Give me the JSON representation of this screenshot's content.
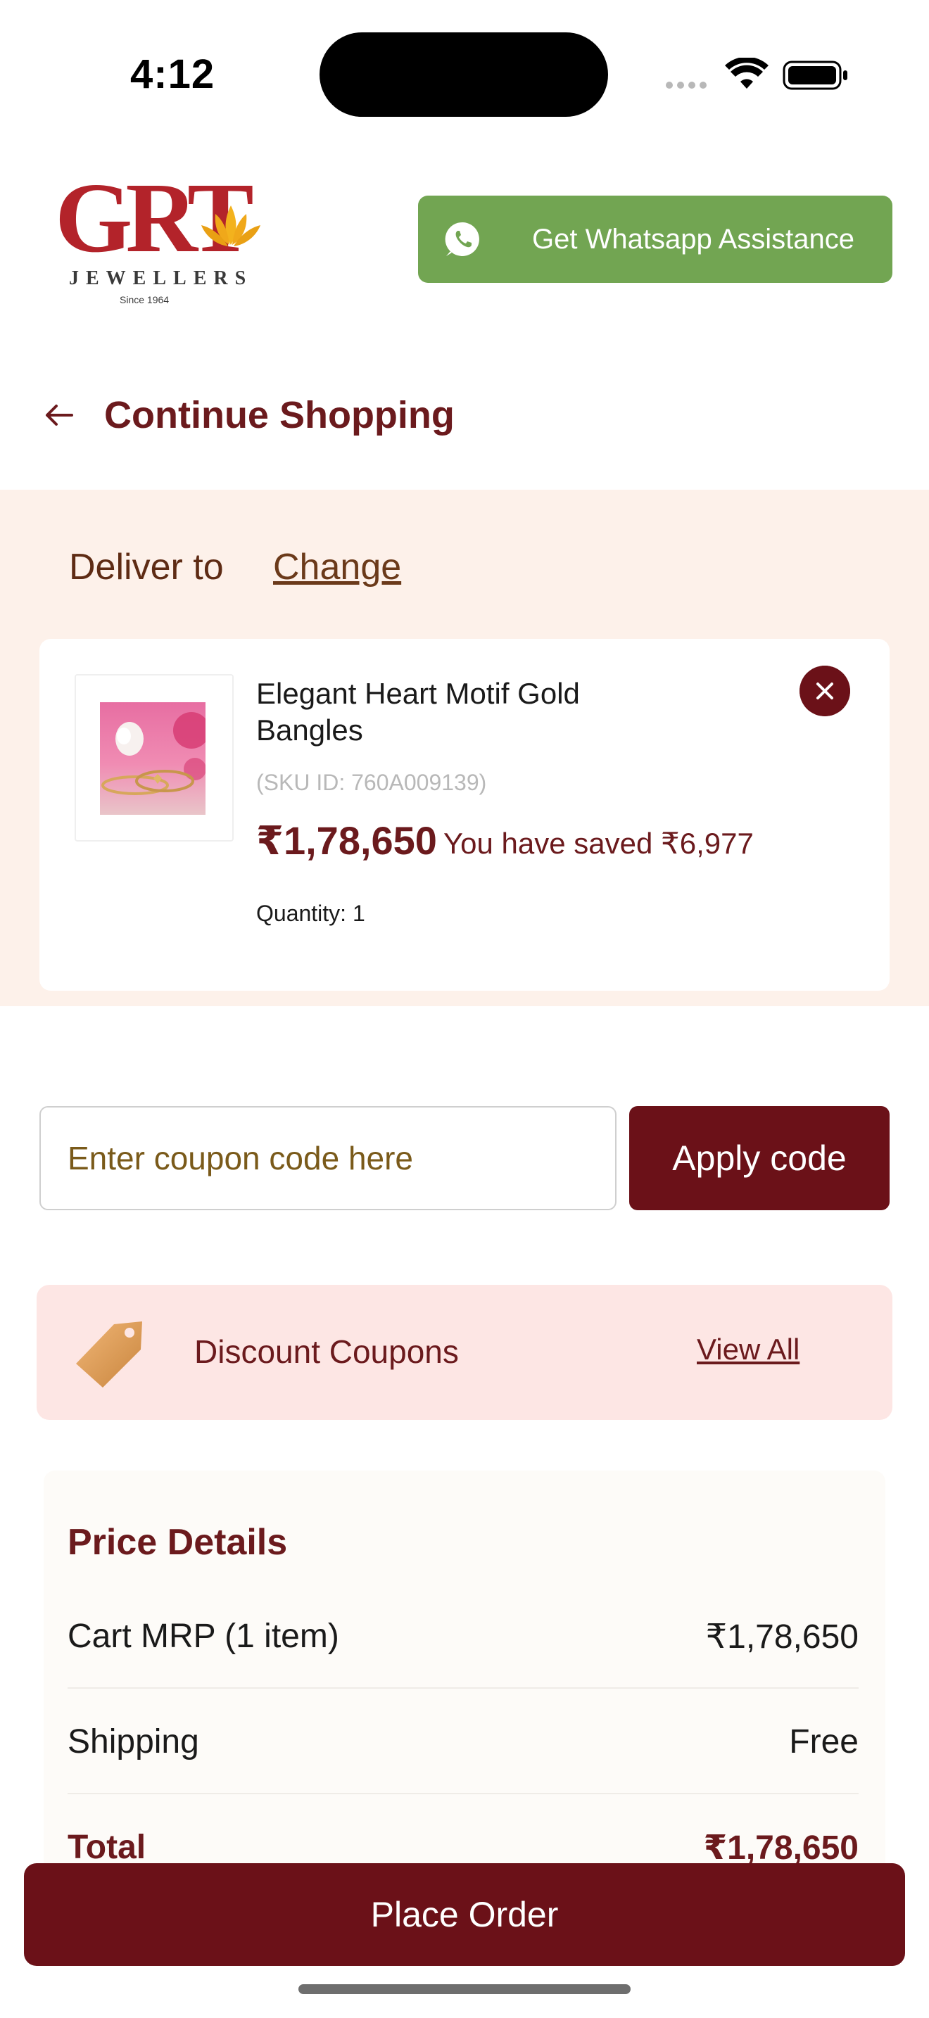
{
  "status_bar": {
    "time": "4:12"
  },
  "header": {
    "logo": {
      "brand": "GRT",
      "subtitle": "JEWELLERS",
      "since": "Since 1964"
    },
    "whatsapp_label": "Get Whatsapp Assistance"
  },
  "nav": {
    "back_label": "Continue Shopping"
  },
  "delivery": {
    "label": "Deliver to",
    "change_label": "Change"
  },
  "cart_item": {
    "name": "Elegant Heart Motif Gold Bangles",
    "sku": "(SKU ID: 760A009139)",
    "price": "₹1,78,650",
    "saved": "You have saved ₹6,977",
    "quantity": "Quantity: 1"
  },
  "coupon": {
    "placeholder": "Enter coupon code here",
    "apply_label": "Apply code",
    "discount_label": "Discount Coupons",
    "view_all_label": "View All"
  },
  "price_details": {
    "title": "Price Details",
    "rows": [
      {
        "label": "Cart MRP (1  item)",
        "value": "₹1,78,650"
      },
      {
        "label": "Shipping",
        "value": "Free"
      },
      {
        "label": "Total",
        "value": "₹1,78,650"
      }
    ]
  },
  "footer": {
    "place_order_label": "Place Order"
  },
  "colors": {
    "maroon": "#6b1118",
    "whatsapp_green": "#72a552",
    "delivery_bg": "#fdf1ea",
    "coupon_bar_bg": "#fde6e4"
  },
  "icons": [
    "wifi-icon",
    "battery-icon",
    "whatsapp-icon",
    "back-arrow-icon",
    "close-icon",
    "tag-icon"
  ]
}
